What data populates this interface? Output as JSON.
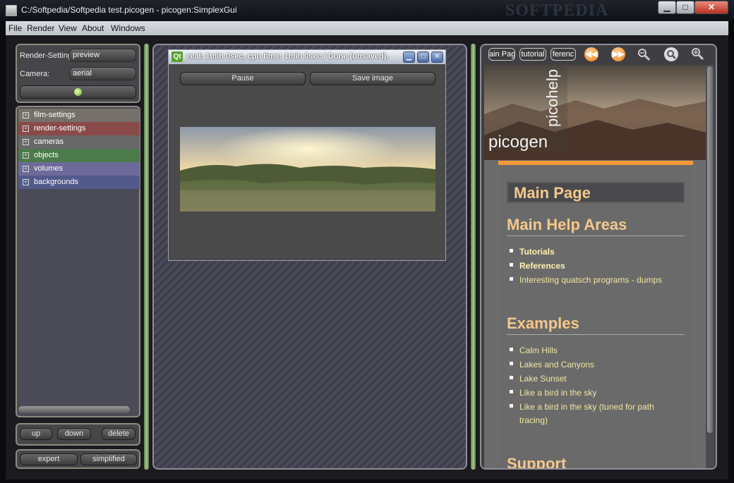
{
  "window": {
    "title": "C:/Softpedia/Softpedia test.picogen - picogen:SimplexGui",
    "controls": {
      "minimize": "▁",
      "maximize": "□",
      "close": "✕"
    },
    "watermark": "SOFTPEDIA"
  },
  "menubar": [
    "File",
    "Render",
    "View",
    "About",
    "Windows"
  ],
  "left_panel": {
    "render_setting_label": "Render-Setting:",
    "render_setting_value": "preview",
    "camera_label": "Camera:",
    "camera_value": "aerial",
    "tree_items": [
      {
        "label": "film-settings",
        "color": "#75706a"
      },
      {
        "label": "render-settings",
        "color": "#8a4a4a"
      },
      {
        "label": "cameras",
        "color": "#686868"
      },
      {
        "label": "objects",
        "color": "#4b7a4b"
      },
      {
        "label": "volumes",
        "color": "#6d6a9a"
      },
      {
        "label": "backgrounds",
        "color": "#515a8a"
      }
    ],
    "order_buttons": {
      "up": "up",
      "down": "down",
      "delete": "delete"
    },
    "mode_buttons": {
      "expert": "expert",
      "simplified": "simplified"
    }
  },
  "render_window": {
    "qt_logo": "Qt",
    "title": "real: 1min 0sec, cpu time: 1min 0sec / Done (unsaved).",
    "pause_button": "Pause",
    "save_button": "Save image"
  },
  "help_panel": {
    "nav": {
      "main_page": "ain Pag",
      "tutorial": "tutorial",
      "references": "ferenc"
    },
    "logo_text": "picogen",
    "logo_vertical_text": "picohelp",
    "main_page_title": "Main Page",
    "sections": [
      {
        "heading": "Main Help Areas",
        "items": [
          {
            "text": "Tutorials",
            "strong": true
          },
          {
            "text": "References",
            "strong": true
          },
          {
            "text": "Interesting quatsch programs - dumps",
            "strong": false
          }
        ]
      },
      {
        "heading": "Examples",
        "items": [
          {
            "text": "Calm Hills",
            "strong": false
          },
          {
            "text": "Lakes and Canyons",
            "strong": false
          },
          {
            "text": "Lake Sunset",
            "strong": false
          },
          {
            "text": "Like a bird in the sky",
            "strong": false
          },
          {
            "text": "Like a bird in the sky (tuned for path tracing)",
            "strong": false
          }
        ]
      },
      {
        "heading": "Support",
        "items": []
      }
    ]
  },
  "colors": {
    "accent_orange": "#f19a3a",
    "heading_color": "#f4c88c",
    "link_color": "#f0e6a0"
  }
}
